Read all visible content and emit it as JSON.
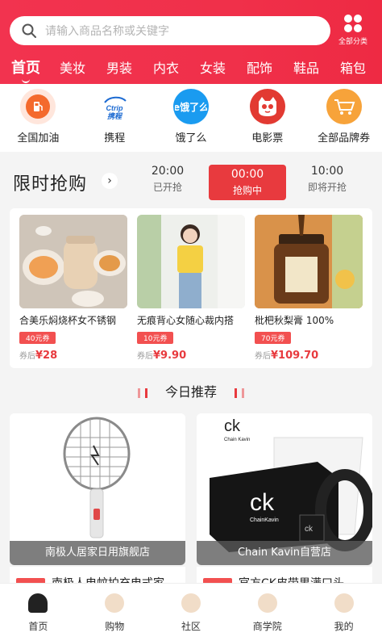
{
  "search": {
    "placeholder": "请输入商品名称或关键字"
  },
  "header": {
    "all_categories_label": "全部分类"
  },
  "categories": [
    {
      "label": "首页",
      "active": true
    },
    {
      "label": "美妆"
    },
    {
      "label": "男装"
    },
    {
      "label": "内衣"
    },
    {
      "label": "女装"
    },
    {
      "label": "配饰"
    },
    {
      "label": "鞋品"
    },
    {
      "label": "箱包"
    }
  ],
  "shortcuts": [
    {
      "label": "全国加油",
      "icon": "fuel-icon"
    },
    {
      "label": "携程",
      "icon": "ctrip-icon",
      "icon_text": "Ctrip\n携程"
    },
    {
      "label": "饿了么",
      "icon": "eleme-icon",
      "icon_text": "e饿了么"
    },
    {
      "label": "电影票",
      "icon": "cat-movie-icon"
    },
    {
      "label": "全部品牌券",
      "icon": "shopping-cart-icon"
    }
  ],
  "flash_sale": {
    "title": "限时抢购",
    "arrow": "›",
    "slots": [
      {
        "time": "20:00",
        "status": "已开抢"
      },
      {
        "time": "00:00",
        "status": "抢购中",
        "active": true
      },
      {
        "time": "10:00",
        "status": "即将开抢"
      }
    ],
    "products": [
      {
        "name": "合美乐焖烧杯女不锈钢",
        "coupon": "40元券",
        "price_prefix": "券后",
        "price": "¥28"
      },
      {
        "name": "无痕背心女随心裁内搭",
        "coupon": "10元券",
        "price_prefix": "券后",
        "price": "¥9.90"
      },
      {
        "name": "枇杷秋梨膏 100%",
        "coupon": "70元券",
        "price_prefix": "券后",
        "price": "¥109.70"
      }
    ]
  },
  "recommend": {
    "title": "今日推荐",
    "cards": [
      {
        "shop": "南极人居家日用旗舰店",
        "peek_text": "南极人电蚊拍充电式家"
      },
      {
        "shop": "Chain Kavin自营店",
        "peek_text": "官方CK皮带男满口头"
      }
    ],
    "ck_logo": "ck",
    "ck_brand": "Chain Kavin",
    "ck_brand_box": "ChainKavin"
  },
  "bottom_nav": [
    {
      "label": "首页",
      "active": true
    },
    {
      "label": "购物"
    },
    {
      "label": "社区"
    },
    {
      "label": "商学院"
    },
    {
      "label": "我的"
    }
  ],
  "colors": {
    "primary": "#f0304a",
    "accent": "#e83a3e"
  }
}
